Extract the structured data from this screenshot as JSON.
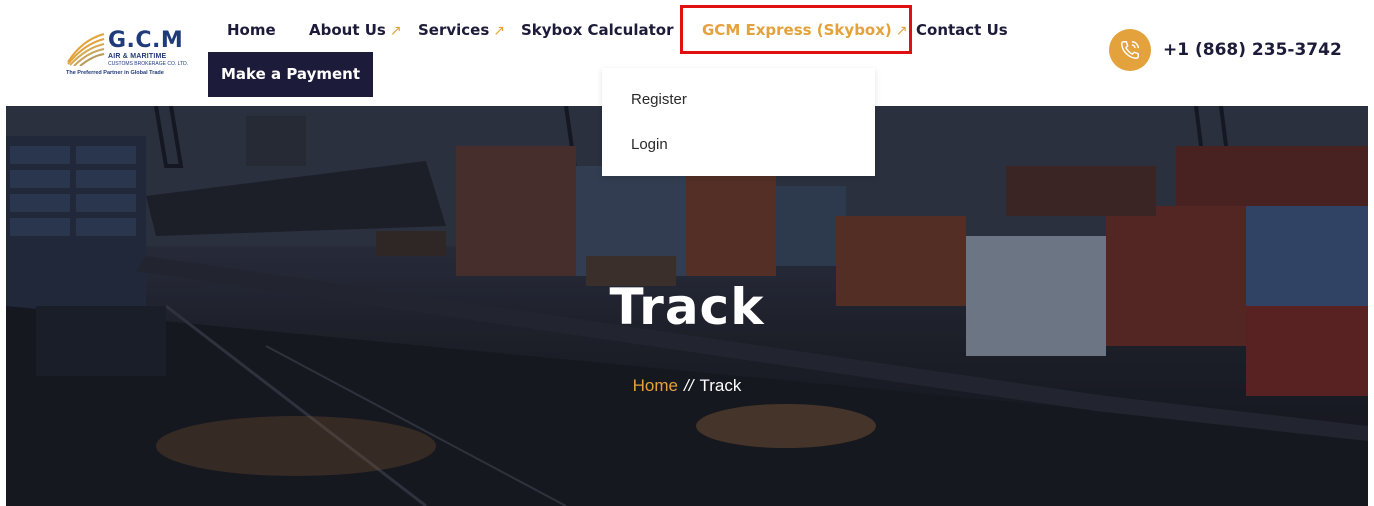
{
  "logo": {
    "title": "G.C.M",
    "sub1": "AIR & MARITIME",
    "sub2": "CUSTOMS BROKERAGE CO. LTD.",
    "tagline": "The Preferred Partner in Global Trade"
  },
  "nav": {
    "home": "Home",
    "about": "About Us",
    "services": "Services",
    "calculator": "Skybox Calculator",
    "express": "GCM Express (Skybox)",
    "contact": "Contact Us",
    "arrow": "↗"
  },
  "payment_button": "Make a Payment",
  "phone": "+1 (868) 235-3742",
  "dropdown": {
    "register": "Register",
    "login": "Login"
  },
  "hero": {
    "title": "Track",
    "breadcrumb_home": "Home",
    "breadcrumb_separator": "//",
    "breadcrumb_current": "Track"
  },
  "colors": {
    "accent": "#e3a23b",
    "navy": "#1d1b3a",
    "highlight": "#e01010"
  }
}
